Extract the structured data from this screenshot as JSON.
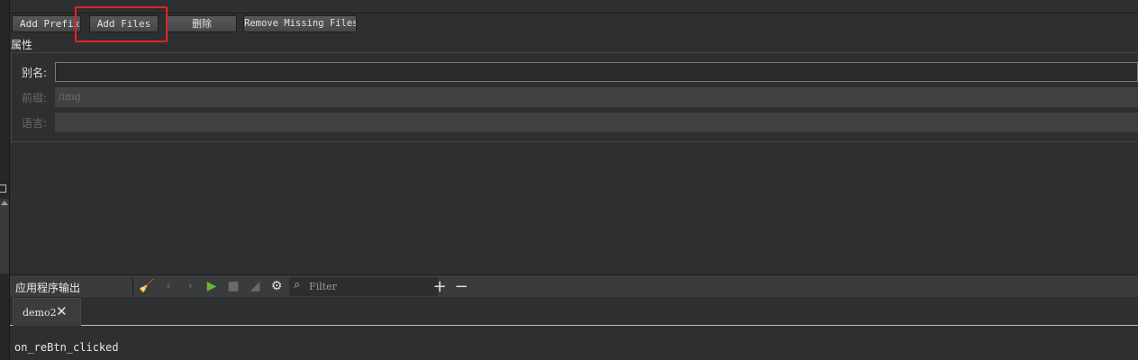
{
  "toolbar": {
    "add_prefix": "Add Prefix",
    "add_files": "Add Files",
    "delete": "删除",
    "remove_missing": "Remove Missing Files"
  },
  "properties": {
    "title": "属性",
    "alias_label": "别名:",
    "alias_value": "",
    "prefix_label": "前缀:",
    "prefix_value": "/img",
    "language_label": "语言:",
    "language_value": ""
  },
  "output_pane": {
    "title": "应用程序输出",
    "filter_placeholder": "Filter",
    "icons": [
      "broom-icon",
      "back-icon",
      "forward-icon",
      "play-icon",
      "stop-icon",
      "attach-icon",
      "gear-icon",
      "search-icon",
      "plus-icon",
      "minus-icon",
      "close-icon"
    ],
    "tabs": [
      {
        "label": "demo2"
      }
    ],
    "lines": [
      "on_reBtn_clicked"
    ]
  },
  "colors": {
    "highlight": "#e52222",
    "run_green": "#69b53a"
  }
}
